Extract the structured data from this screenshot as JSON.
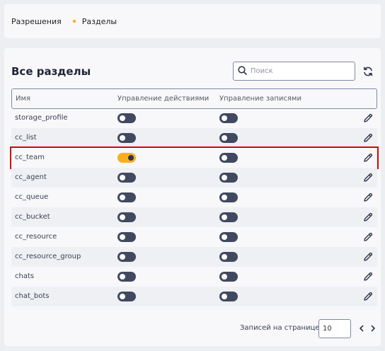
{
  "breadcrumb": {
    "items": [
      "Разрешения",
      "Разделы"
    ]
  },
  "panel": {
    "title": "Все разделы"
  },
  "search": {
    "placeholder": "Поиск"
  },
  "table": {
    "columns": [
      "Имя",
      "Управление действиями",
      "Управление записями"
    ],
    "rows": [
      {
        "name": "storage_profile",
        "actions": false,
        "records": false
      },
      {
        "name": "cc_list",
        "actions": false,
        "records": false
      },
      {
        "name": "cc_team",
        "actions": true,
        "records": false
      },
      {
        "name": "cc_agent",
        "actions": false,
        "records": false
      },
      {
        "name": "cc_queue",
        "actions": false,
        "records": false
      },
      {
        "name": "cc_bucket",
        "actions": false,
        "records": false
      },
      {
        "name": "cc_resource",
        "actions": false,
        "records": false
      },
      {
        "name": "cc_resource_group",
        "actions": false,
        "records": false
      },
      {
        "name": "chats",
        "actions": false,
        "records": false
      },
      {
        "name": "chat_bots",
        "actions": false,
        "records": false
      }
    ]
  },
  "pagination": {
    "per_page_label": "Записей на странице:",
    "per_page_value": "10"
  },
  "colors": {
    "accent": "#f7b020",
    "toggle_off": "#414960",
    "highlight": "#e00000"
  }
}
